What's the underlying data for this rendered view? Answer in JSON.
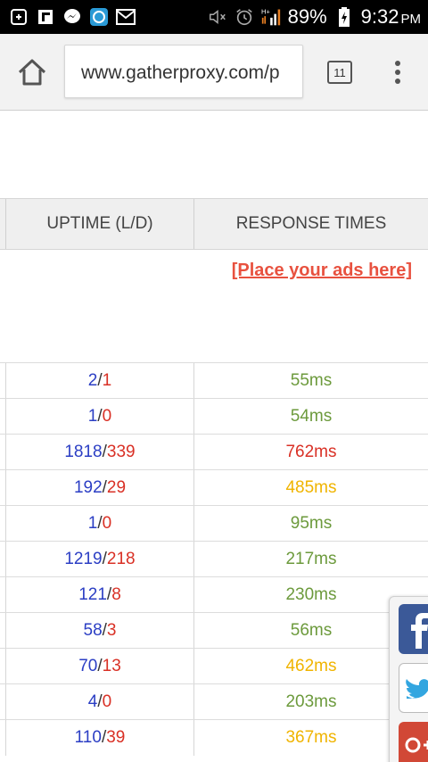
{
  "status_bar": {
    "battery": "89%",
    "time": "9:32",
    "ampm": "PM",
    "icons_left": [
      "sd-card-icon",
      "flipboard-icon",
      "messenger-icon",
      "browser-app-icon",
      "gmail-icon"
    ],
    "icons_right": [
      "mute-icon",
      "alarm-icon",
      "signal-icon",
      "battery-icon"
    ]
  },
  "browser": {
    "url": "www.gatherproxy.com/p",
    "tab_count": "11"
  },
  "table": {
    "headers": {
      "uptime": "UPTIME (L/D)",
      "response": "RESPONSE TIMES"
    },
    "ad_text": "[Place your ads here]",
    "rows": [
      {
        "live": "2",
        "dead": "1",
        "response": "55ms",
        "color": "#6c9a3c"
      },
      {
        "live": "1",
        "dead": "0",
        "response": "54ms",
        "color": "#6c9a3c"
      },
      {
        "live": "1818",
        "dead": "339",
        "response": "762ms",
        "color": "#d93025"
      },
      {
        "live": "192",
        "dead": "29",
        "response": "485ms",
        "color": "#f0b400"
      },
      {
        "live": "1",
        "dead": "0",
        "response": "95ms",
        "color": "#6c9a3c"
      },
      {
        "live": "1219",
        "dead": "218",
        "response": "217ms",
        "color": "#6c9a3c"
      },
      {
        "live": "121",
        "dead": "8",
        "response": "230ms",
        "color": "#6c9a3c"
      },
      {
        "live": "58",
        "dead": "3",
        "response": "56ms",
        "color": "#6c9a3c"
      },
      {
        "live": "70",
        "dead": "13",
        "response": "462ms",
        "color": "#f0b400"
      },
      {
        "live": "4",
        "dead": "0",
        "response": "203ms",
        "color": "#6c9a3c"
      },
      {
        "live": "110",
        "dead": "39",
        "response": "367ms",
        "color": "#f0b400"
      }
    ]
  },
  "social": [
    "facebook-icon",
    "twitter-icon",
    "google-plus-icon"
  ],
  "colors": {
    "live": "#2b3ec4",
    "dead": "#d93025",
    "fast": "#6c9a3c",
    "medium": "#f0b400",
    "slow": "#d93025",
    "ad": "#e8513f"
  }
}
